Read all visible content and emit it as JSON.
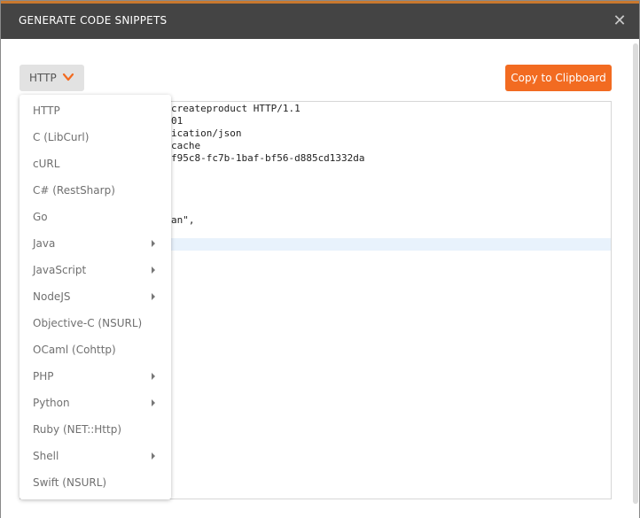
{
  "header": {
    "title": "GENERATE CODE SNIPPETS",
    "close_glyph": "✕"
  },
  "toolbar": {
    "selected_language": "HTTP",
    "copy_label": "Copy to Clipboard"
  },
  "code_lines": [
    "createproduct HTTP/1.1",
    "01",
    "ication/json",
    "cache",
    "f95c8-fc7b-1baf-bf56-d885cd1332da",
    "",
    "",
    "",
    "an\","
  ],
  "languages": [
    {
      "label": "HTTP",
      "has_submenu": false
    },
    {
      "label": "C (LibCurl)",
      "has_submenu": false
    },
    {
      "label": "cURL",
      "has_submenu": false
    },
    {
      "label": "C# (RestSharp)",
      "has_submenu": false
    },
    {
      "label": "Go",
      "has_submenu": false
    },
    {
      "label": "Java",
      "has_submenu": true
    },
    {
      "label": "JavaScript",
      "has_submenu": true
    },
    {
      "label": "NodeJS",
      "has_submenu": true
    },
    {
      "label": "Objective-C (NSURL)",
      "has_submenu": false
    },
    {
      "label": "OCaml (Cohttp)",
      "has_submenu": false
    },
    {
      "label": "PHP",
      "has_submenu": true
    },
    {
      "label": "Python",
      "has_submenu": true
    },
    {
      "label": "Ruby (NET::Http)",
      "has_submenu": false
    },
    {
      "label": "Shell",
      "has_submenu": true
    },
    {
      "label": "Swift (NSURL)",
      "has_submenu": false
    }
  ],
  "colors": {
    "accent": "#f26b21",
    "header_bg": "#444444",
    "menu_text": "#707070"
  },
  "icons": {
    "close": "close-icon",
    "dropdown": "chevron-down-icon",
    "submenu": "caret-right-icon"
  }
}
